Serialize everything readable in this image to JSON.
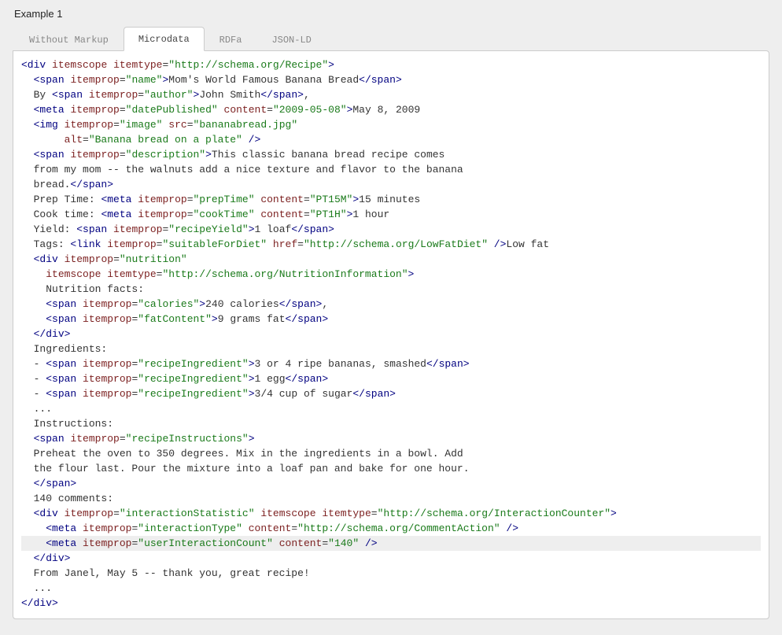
{
  "title": "Example 1",
  "tabs": [
    {
      "label": "Without Markup"
    },
    {
      "label": "Microdata"
    },
    {
      "label": "RDFa"
    },
    {
      "label": "JSON-LD"
    }
  ],
  "code": {
    "line1": {
      "tag_open": "<div",
      "attr1": "itemscope",
      "attr2": "itemtype",
      "val2": "\"http://schema.org/Recipe\"",
      "gt": ">"
    },
    "line2": {
      "indent": "  ",
      "tag_open": "<span",
      "attr1": "itemprop",
      "val1": "\"name\"",
      "gt": ">",
      "text": "Mom's World Famous Banana Bread",
      "tag_close": "</span>"
    },
    "line3": {
      "indent": "  ",
      "pre": "By ",
      "tag_open": "<span",
      "attr1": "itemprop",
      "val1": "\"author\"",
      "gt": ">",
      "text": "John Smith",
      "tag_close": "</span>",
      "post": ","
    },
    "line4": {
      "indent": "  ",
      "tag_open": "<meta",
      "attr1": "itemprop",
      "val1": "\"datePublished\"",
      "attr2": "content",
      "val2": "\"2009-05-08\"",
      "gt": ">",
      "text": "May 8, 2009"
    },
    "line5": {
      "indent": "  ",
      "tag_open": "<img",
      "attr1": "itemprop",
      "val1": "\"image\"",
      "attr2": "src",
      "val2": "\"bananabread.jpg\""
    },
    "line6": {
      "indent": "       ",
      "attr1": "alt",
      "val1": "\"Banana bread on a plate\"",
      "close": " />"
    },
    "line7": {
      "indent": "  ",
      "tag_open": "<span",
      "attr1": "itemprop",
      "val1": "\"description\"",
      "gt": ">",
      "text": "This classic banana bread recipe comes"
    },
    "line8": {
      "indent": "  ",
      "text": "from my mom -- the walnuts add a nice texture and flavor to the banana"
    },
    "line9": {
      "indent": "  ",
      "text": "bread.",
      "tag_close": "</span>"
    },
    "line10": {
      "indent": "  ",
      "pre": "Prep Time: ",
      "tag_open": "<meta",
      "attr1": "itemprop",
      "val1": "\"prepTime\"",
      "attr2": "content",
      "val2": "\"PT15M\"",
      "gt": ">",
      "text": "15 minutes"
    },
    "line11": {
      "indent": "  ",
      "pre": "Cook time: ",
      "tag_open": "<meta",
      "attr1": "itemprop",
      "val1": "\"cookTime\"",
      "attr2": "content",
      "val2": "\"PT1H\"",
      "gt": ">",
      "text": "1 hour"
    },
    "line12": {
      "indent": "  ",
      "pre": "Yield: ",
      "tag_open": "<span",
      "attr1": "itemprop",
      "val1": "\"recipeYield\"",
      "gt": ">",
      "text": "1 loaf",
      "tag_close": "</span>"
    },
    "line13": {
      "indent": "  ",
      "pre": "Tags: ",
      "tag_open": "<link",
      "attr1": "itemprop",
      "val1": "\"suitableForDiet\"",
      "attr2": "href",
      "val2": "\"http://schema.org/LowFatDiet\"",
      "close": " />",
      "text": "Low fat"
    },
    "line14": {
      "indent": "  ",
      "tag_open": "<div",
      "attr1": "itemprop",
      "val1": "\"nutrition\""
    },
    "line15": {
      "indent": "    ",
      "attr1": "itemscope",
      "attr2": "itemtype",
      "val2": "\"http://schema.org/NutritionInformation\"",
      "gt": ">"
    },
    "line16": {
      "indent": "    ",
      "text": "Nutrition facts:"
    },
    "line17": {
      "indent": "    ",
      "tag_open": "<span",
      "attr1": "itemprop",
      "val1": "\"calories\"",
      "gt": ">",
      "text": "240 calories",
      "tag_close": "</span>",
      "post": ","
    },
    "line18": {
      "indent": "    ",
      "tag_open": "<span",
      "attr1": "itemprop",
      "val1": "\"fatContent\"",
      "gt": ">",
      "text": "9 grams fat",
      "tag_close": "</span>"
    },
    "line19": {
      "indent": "  ",
      "tag_close": "</div>"
    },
    "line20": {
      "indent": "  ",
      "text": "Ingredients:"
    },
    "line21": {
      "indent": "  ",
      "pre": "- ",
      "tag_open": "<span",
      "attr1": "itemprop",
      "val1": "\"recipeIngredient\"",
      "gt": ">",
      "text": "3 or 4 ripe bananas, smashed",
      "tag_close": "</span>"
    },
    "line22": {
      "indent": "  ",
      "pre": "- ",
      "tag_open": "<span",
      "attr1": "itemprop",
      "val1": "\"recipeIngredient\"",
      "gt": ">",
      "text": "1 egg",
      "tag_close": "</span>"
    },
    "line23": {
      "indent": "  ",
      "pre": "- ",
      "tag_open": "<span",
      "attr1": "itemprop",
      "val1": "\"recipeIngredient\"",
      "gt": ">",
      "text": "3/4 cup of sugar",
      "tag_close": "</span>"
    },
    "line24": {
      "indent": "  ",
      "text": "..."
    },
    "line25": {
      "indent": "  ",
      "text": "Instructions:"
    },
    "line26": {
      "indent": "  ",
      "tag_open": "<span",
      "attr1": "itemprop",
      "val1": "\"recipeInstructions\"",
      "gt": ">"
    },
    "line27": {
      "indent": "  ",
      "text": "Preheat the oven to 350 degrees. Mix in the ingredients in a bowl. Add"
    },
    "line28": {
      "indent": "  ",
      "text": "the flour last. Pour the mixture into a loaf pan and bake for one hour."
    },
    "line29": {
      "indent": "  ",
      "tag_close": "</span>"
    },
    "line30": {
      "indent": "  ",
      "text": "140 comments:"
    },
    "line31": {
      "indent": "  ",
      "tag_open": "<div",
      "attr1": "itemprop",
      "val1": "\"interactionStatistic\"",
      "attr2": "itemscope",
      "attr3": "itemtype",
      "val3": "\"http://schema.org/InteractionCounter\"",
      "gt": ">"
    },
    "line32": {
      "indent": "    ",
      "tag_open": "<meta",
      "attr1": "itemprop",
      "val1": "\"interactionType\"",
      "attr2": "content",
      "val2": "\"http://schema.org/CommentAction\"",
      "close": " />"
    },
    "line33": {
      "indent": "    ",
      "tag_open": "<meta",
      "attr1": "itemprop",
      "val1": "\"userInteractionCount\"",
      "attr2": "content",
      "val2": "\"140\"",
      "close": " />"
    },
    "line34": {
      "indent": "  ",
      "tag_close": "</div>"
    },
    "line35": {
      "indent": "  ",
      "text": "From Janel, May 5 -- thank you, great recipe!"
    },
    "line36": {
      "indent": "  ",
      "text": "..."
    },
    "line37": {
      "tag_close": "</div>"
    }
  }
}
